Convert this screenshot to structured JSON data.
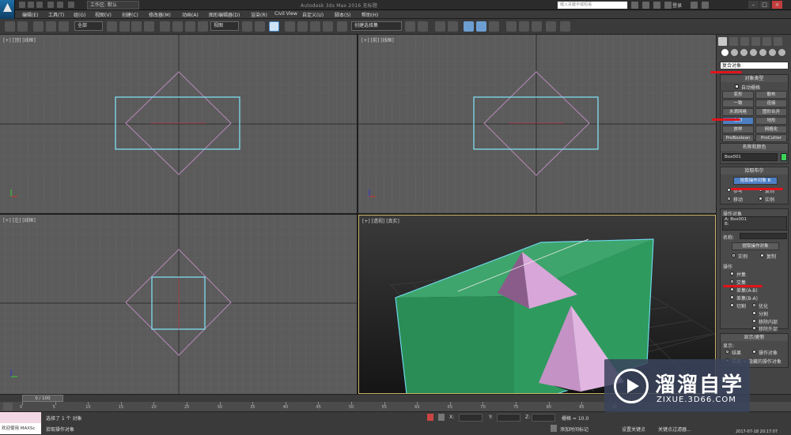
{
  "window": {
    "workspace": "工作区: 默认",
    "title": "Autodesk 3ds Max 2016    无标题",
    "search_placeholder": "键入关键字或短语",
    "login": "登录"
  },
  "menu": [
    "编辑(E)",
    "工具(T)",
    "组(G)",
    "视图(V)",
    "创建(C)",
    "修改器(M)",
    "动画(A)",
    "图形编辑器(D)",
    "渲染(R)",
    "Civil View",
    "自定义(U)",
    "脚本(S)",
    "帮助(H)"
  ],
  "toolbar": {
    "selection_filter": "全部",
    "ref_coord": "视图",
    "named_selection": "创建选择集"
  },
  "viewports": {
    "top": "[+] [顶] [线框]",
    "front": "[+] [前] [线框]",
    "left": "[+] [左] [线框]",
    "persp": "[+] [透视] [真实]"
  },
  "command_panel": {
    "category": "复合对象",
    "object_type": {
      "title": "对象类型",
      "autogrid": "自动栅格",
      "buttons": [
        "变形",
        "散布",
        "一致",
        "连接",
        "水滴网格",
        "图形合并",
        "布尔",
        "地形",
        "放样",
        "网格化",
        "ProBoolean",
        "ProCutter"
      ]
    },
    "name_color": {
      "title": "名称和颜色",
      "name": "Box001",
      "color": "#3cd25a"
    },
    "pick_boolean": {
      "title": "拾取布尔",
      "pick_button": "拾取操作对象 B",
      "options": [
        "参考",
        "复制",
        "移动",
        "实例"
      ]
    },
    "parameters": {
      "operands_title": "操作对象",
      "operands": [
        "A: Box001",
        "B:"
      ],
      "name_label": "名称:",
      "extract_button": "提取操作对象",
      "extract_options": [
        "实例",
        "复制"
      ],
      "operation_title": "操作",
      "operations": [
        "并集",
        "交集",
        "差集(A-B)",
        "差集(B-A)"
      ],
      "cut_label": "切割",
      "cut_options": [
        "优化",
        "分割",
        "移除内部",
        "移除外部"
      ]
    },
    "display_update": {
      "title": "显示/更新",
      "display_label": "显示:",
      "display_options": [
        "结果",
        "操作对象",
        "结果 + 隐藏的操作对象"
      ]
    }
  },
  "timeline": {
    "frame": "0 / 100",
    "ticks": [
      "0",
      "5",
      "10",
      "15",
      "20",
      "25",
      "30",
      "35",
      "40",
      "45",
      "50",
      "55",
      "60",
      "65",
      "70",
      "75",
      "80",
      "85",
      "90"
    ]
  },
  "status": {
    "maxscript": "欢迎使用 MAXSc",
    "selected": "选择了 1 个 对象",
    "prompt": "拾取操作对象",
    "grid": "栅格 = 10.0",
    "add_time_tag": "添加时间标记",
    "set_key": "设置关键点",
    "key_filters": "关键点过滤器...",
    "datetime": "2017-07-18  20:17:07"
  },
  "watermark": {
    "title": "溜溜自学",
    "subtitle": "ZIXUE.3D66.COM"
  }
}
